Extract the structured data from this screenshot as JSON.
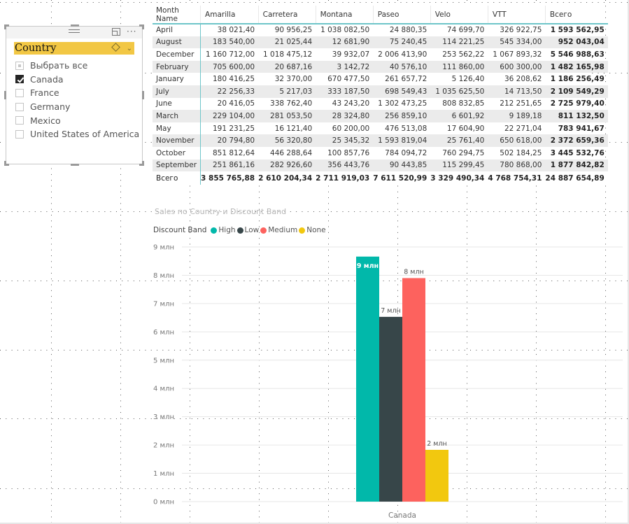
{
  "slicer": {
    "title": "Country",
    "items": [
      {
        "label": "Выбрать все",
        "state": "partial"
      },
      {
        "label": "Canada",
        "state": "checked"
      },
      {
        "label": "France",
        "state": "unchecked"
      },
      {
        "label": "Germany",
        "state": "unchecked"
      },
      {
        "label": "Mexico",
        "state": "unchecked"
      },
      {
        "label": "United States of America",
        "state": "unchecked"
      }
    ],
    "icons": {
      "grip": "drag-grip-icon",
      "focus": "focus-mode-icon",
      "more": "more-options-icon",
      "eraser": "clear-selection-icon",
      "chevron": "chevron-down-icon"
    },
    "more_glyph": "···",
    "chevron_glyph": "⌄"
  },
  "matrix": {
    "columns": [
      "Month Name",
      "Amarilla",
      "Carretera",
      "Montana",
      "Paseo",
      "Velo",
      "VTT",
      "Всего"
    ],
    "rows": [
      [
        "April",
        "38 021,40",
        "90 956,25",
        "1 038 082,50",
        "24 880,35",
        "74 699,70",
        "326 922,75",
        "1 593 562,95"
      ],
      [
        "August",
        "183 540,00",
        "21 025,44",
        "12 681,90",
        "75 240,45",
        "114 221,25",
        "545 334,00",
        "952 043,04"
      ],
      [
        "December",
        "1 160 712,00",
        "1 018 475,12",
        "39 932,07",
        "2 006 413,90",
        "253 562,22",
        "1 067 893,32",
        "5 546 988,63"
      ],
      [
        "February",
        "705 600,00",
        "20 687,16",
        "3 142,72",
        "40 576,10",
        "111 860,00",
        "600 300,00",
        "1 482 165,98"
      ],
      [
        "January",
        "180 416,25",
        "32 370,00",
        "670 477,50",
        "261 657,72",
        "5 126,40",
        "36 208,62",
        "1 186 256,49"
      ],
      [
        "July",
        "22 256,33",
        "5 217,03",
        "333 187,50",
        "698 549,43",
        "1 035 625,50",
        "14 713,50",
        "2 109 549,29"
      ],
      [
        "June",
        "20 416,05",
        "338 762,40",
        "43 243,20",
        "1 302 473,25",
        "808 832,85",
        "212 251,65",
        "2 725 979,40"
      ],
      [
        "March",
        "229 104,00",
        "281 053,50",
        "28 324,80",
        "256 859,10",
        "6 601,92",
        "9 189,18",
        "811 132,50"
      ],
      [
        "May",
        "191 231,25",
        "16 121,40",
        "60 200,00",
        "476 513,08",
        "17 604,90",
        "22 271,04",
        "783 941,67"
      ],
      [
        "November",
        "20 794,80",
        "56 320,80",
        "25 345,32",
        "1 593 819,04",
        "25 761,40",
        "650 618,00",
        "2 372 659,36"
      ],
      [
        "October",
        "851 812,64",
        "446 288,64",
        "100 857,76",
        "784 094,72",
        "760 294,75",
        "502 184,25",
        "3 445 532,76"
      ],
      [
        "September",
        "251 861,16",
        "282 926,60",
        "356 443,76",
        "90 443,85",
        "115 299,45",
        "780 868,00",
        "1 877 842,82"
      ]
    ],
    "total_row": [
      "Всего",
      "3 855 765,88",
      "2 610 204,34",
      "2 711 919,03",
      "7 611 520,99",
      "3 329 490,34",
      "4 768 754,31",
      "24 887 654,89"
    ]
  },
  "chart_data": {
    "type": "bar",
    "title": "Sales по Country и Discount Band",
    "legend_title": "Discount Band",
    "legend_position": "top-left",
    "categories": [
      "Canada"
    ],
    "series": [
      {
        "name": "High",
        "color": "#01b8aa",
        "values": [
          8.66
        ],
        "label": "9 млн",
        "label_inside": true
      },
      {
        "name": "Low",
        "color": "#374649",
        "values": [
          6.53
        ],
        "label": "7 млн",
        "label_inside": false
      },
      {
        "name": "Medium",
        "color": "#fd625e",
        "values": [
          7.9
        ],
        "label": "8 млн",
        "label_inside": false
      },
      {
        "name": "None",
        "color": "#f2c80f",
        "values": [
          1.83
        ],
        "label": "2 млн",
        "label_inside": false
      }
    ],
    "y_unit": "млн",
    "ylim": [
      0,
      9
    ],
    "y_ticks": [
      "0 млн",
      "1 млн",
      "2 млн",
      "3 млн",
      "4 млн",
      "5 млн",
      "6 млн",
      "7 млн",
      "8 млн",
      "9 млн"
    ],
    "grid": true,
    "xlabel": "",
    "ylabel": ""
  }
}
